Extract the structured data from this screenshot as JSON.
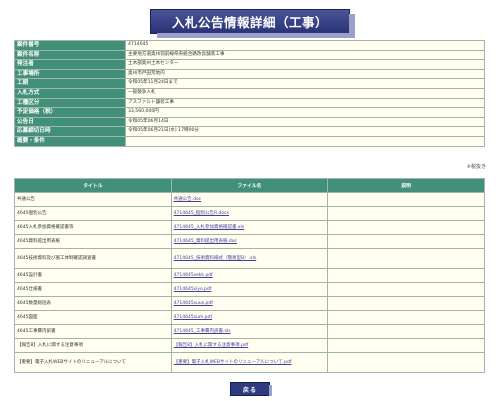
{
  "page_title": "入札公告情報詳細（工事）",
  "info_rows": [
    {
      "label": "案件番号",
      "value": "4714645"
    },
    {
      "label": "案件名称",
      "value": "主要地方道奥州羽前線県央統合路改良舗装工事"
    },
    {
      "label": "発注者",
      "value": "土木部奥州土木センター"
    },
    {
      "label": "工事場所",
      "value": "奥州市戸田荒地内"
    },
    {
      "label": "工期",
      "value": "令和05年11月24日まで"
    },
    {
      "label": "入札方式",
      "value": "一般競争入札"
    },
    {
      "label": "工種区分",
      "value": "アスファルト舗装工事"
    },
    {
      "label": "予定価格（税）",
      "value": "33,560,000円"
    },
    {
      "label": "公告日",
      "value": "令和05年06月14日"
    },
    {
      "label": "応募締切日時",
      "value": "令和05年06月21日(水) 17時00分"
    },
    {
      "label": "概要・条件",
      "value": ""
    }
  ],
  "tax_note": "※税抜き",
  "files_table": {
    "headers": [
      "タイトル",
      "ファイル名",
      "説明"
    ],
    "rows": [
      {
        "title": "共通公告",
        "file": "共通公告.doc",
        "desc": ""
      },
      {
        "title": "4645個別公告",
        "file": "4714645_個別公告R.docx",
        "desc": ""
      },
      {
        "title": "4645入札参加資格確認書等",
        "file": "4714645_入札参加資格確認書.xls",
        "desc": ""
      },
      {
        "title": "4645資料提出用表紙",
        "file": "4714645_資料提出用表紙.doc",
        "desc": ""
      },
      {
        "title": "4645技術資料及び施工体制確認調査書",
        "file": "4714645_技術資料様式（簡易型B）.xls",
        "desc": ""
      },
      {
        "title": "4645設計書",
        "file": "4714645sekk.pdf",
        "desc": ""
      },
      {
        "title": "4645仕様書",
        "file": "4714645siyo.pdf",
        "desc": ""
      },
      {
        "title": "4645数量総括表",
        "file": "4714645suus.pdf",
        "desc": ""
      },
      {
        "title": "4645図面",
        "file": "4714645zum.pdf",
        "desc": ""
      },
      {
        "title": "4645工事費内訳書",
        "file": "4714645_工事費内訳書.xls",
        "desc": ""
      },
      {
        "title": "【報告8】入札に関する注意事項",
        "file": "【報告8】入札に関する注意事項.pdf",
        "desc": ""
      },
      {
        "title": "【重要】電子入札WEBサイトのリニューアルについて",
        "file": "【重要】電子入札WEBサイトのリニューアルについて.pdf",
        "desc": ""
      }
    ]
  },
  "back_button": "戻る"
}
